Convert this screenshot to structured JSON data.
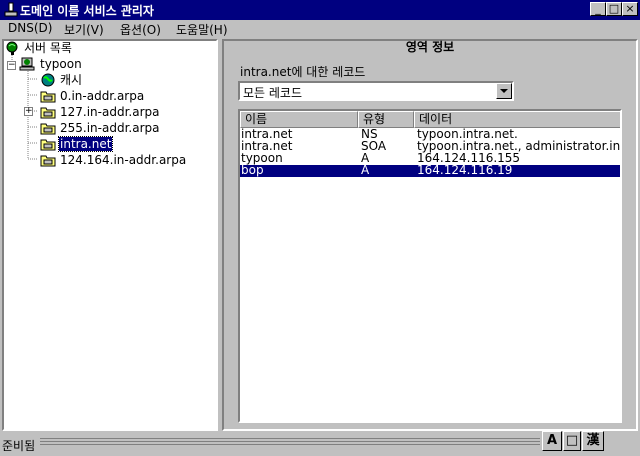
{
  "window": {
    "title": "도메인 이름 서비스 관리자",
    "controls": {
      "minimize": "_",
      "maximize": "□",
      "close": "×"
    }
  },
  "menu": [
    {
      "label": "DNS(D)"
    },
    {
      "label": "보기(V)"
    },
    {
      "label": "옵션(O)"
    },
    {
      "label": "도움말(H)"
    }
  ],
  "tree": {
    "root_label": "서버 목록",
    "server_label": "typoon",
    "nodes": [
      {
        "label": "캐시",
        "icon": "globe-icon"
      },
      {
        "label": "0.in-addr.arpa",
        "icon": "zone-folder-icon"
      },
      {
        "label": "127.in-addr.arpa",
        "icon": "zone-folder-icon",
        "expander": "+"
      },
      {
        "label": "255.in-addr.arpa",
        "icon": "zone-folder-icon"
      },
      {
        "label": "intra.net",
        "icon": "zone-folder-icon",
        "selected": true
      },
      {
        "label": "124.164.in-addr.arpa",
        "icon": "zone-folder-icon"
      }
    ]
  },
  "zone_info": {
    "title": "영역 정보",
    "records_label": "intra.net에 대한 레코드",
    "record_filter": "모든 레코드",
    "columns": [
      "이름",
      "유형",
      "데이터"
    ],
    "rows": [
      {
        "name": "intra.net",
        "type": "NS",
        "data": "typoon.intra.net."
      },
      {
        "name": "intra.net",
        "type": "SOA",
        "data": "typoon.intra.net., administrator.intra"
      },
      {
        "name": "typoon",
        "type": "A",
        "data": "164.124.116.155"
      },
      {
        "name": "bop",
        "type": "A",
        "data": "164.124.116.19",
        "selected": true
      }
    ]
  },
  "status": {
    "text": "준비됨",
    "ime_buttons": [
      "A",
      "□",
      "漢"
    ]
  },
  "colors": {
    "title_bar": "#000080",
    "selection": "#000080",
    "face": "#c0c0c0"
  }
}
